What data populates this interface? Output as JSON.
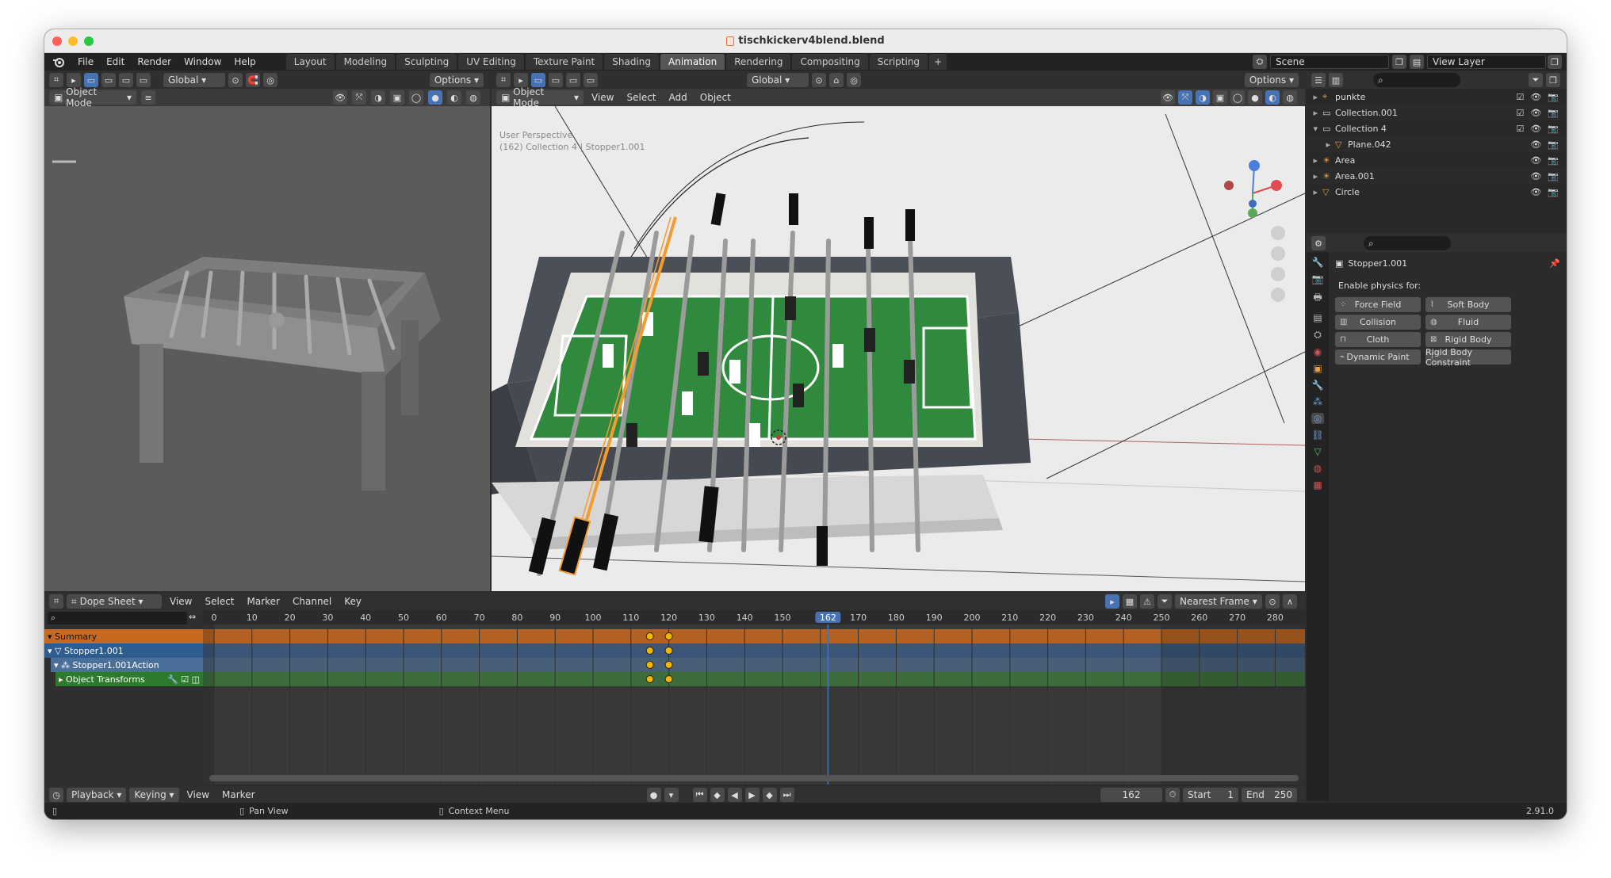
{
  "window": {
    "title": "tischkickerv4blend.blend",
    "traffic_lights": {
      "close": "#ff5f57",
      "minimize": "#febc2e",
      "zoom": "#28c840"
    }
  },
  "menu": [
    "File",
    "Edit",
    "Render",
    "Window",
    "Help"
  ],
  "workspaces": [
    "Layout",
    "Modeling",
    "Sculpting",
    "UV Editing",
    "Texture Paint",
    "Shading",
    "Animation",
    "Rendering",
    "Compositing",
    "Scripting"
  ],
  "active_workspace": "Animation",
  "scene": "Scene",
  "view_layer": "View Layer",
  "left_viewport": {
    "transform": "Global",
    "options": "Options",
    "mode": "Object Mode"
  },
  "main_viewport": {
    "mode": "Object Mode",
    "menus": [
      "View",
      "Select",
      "Add",
      "Object"
    ],
    "transform": "Global",
    "options": "Options",
    "overlay_line1": "User Perspective",
    "overlay_line2": "(162) Collection 4 | Stopper1.001"
  },
  "outliner": {
    "items": [
      {
        "name": "punkte",
        "depth": 0,
        "expanded": false,
        "type": "empty",
        "checkbox": true
      },
      {
        "name": "Collection.001",
        "depth": 0,
        "expanded": false,
        "type": "collection",
        "checkbox": true
      },
      {
        "name": "Collection 4",
        "depth": 0,
        "expanded": true,
        "type": "collection",
        "checkbox": true
      },
      {
        "name": "Plane.042",
        "depth": 1,
        "expanded": false,
        "type": "mesh",
        "checkbox": false
      },
      {
        "name": "Area",
        "depth": 0,
        "expanded": false,
        "type": "light",
        "checkbox": false
      },
      {
        "name": "Area.001",
        "depth": 0,
        "expanded": false,
        "type": "light",
        "checkbox": false
      },
      {
        "name": "Circle",
        "depth": 0,
        "expanded": false,
        "type": "mesh",
        "checkbox": false
      }
    ]
  },
  "properties": {
    "object": "Stopper1.001",
    "section": "Enable physics for:",
    "buttons": [
      [
        "Force Field",
        "Soft Body"
      ],
      [
        "Collision",
        "Fluid"
      ],
      [
        "Cloth",
        "Rigid Body"
      ],
      [
        "Dynamic Paint",
        "Rigid Body Constraint"
      ]
    ]
  },
  "dopesheet": {
    "editor": "Dope Sheet",
    "menus": [
      "View",
      "Select",
      "Marker",
      "Channel",
      "Key"
    ],
    "snap": "Nearest Frame",
    "ticks": [
      "0",
      "10",
      "20",
      "30",
      "40",
      "50",
      "60",
      "70",
      "80",
      "90",
      "100",
      "110",
      "120",
      "130",
      "140",
      "150",
      "1",
      "170",
      "180",
      "190",
      "200",
      "210",
      "220",
      "230",
      "240",
      "250",
      "260",
      "270",
      "280"
    ],
    "current_frame": "162",
    "channels": [
      {
        "name": "Summary"
      },
      {
        "name": "Stopper1.001"
      },
      {
        "name": "Stopper1.001Action"
      },
      {
        "name": "Object Transforms"
      }
    ],
    "keyframes": [
      115,
      120
    ],
    "frame_end": 250
  },
  "timeline": {
    "menus": [
      "Playback",
      "Keying",
      "View",
      "Marker"
    ],
    "current": "162",
    "start_label": "Start",
    "start": "1",
    "end_label": "End",
    "end": "250"
  },
  "statusbar": {
    "pan": "Pan View",
    "context": "Context Menu",
    "version": "2.91.0"
  }
}
